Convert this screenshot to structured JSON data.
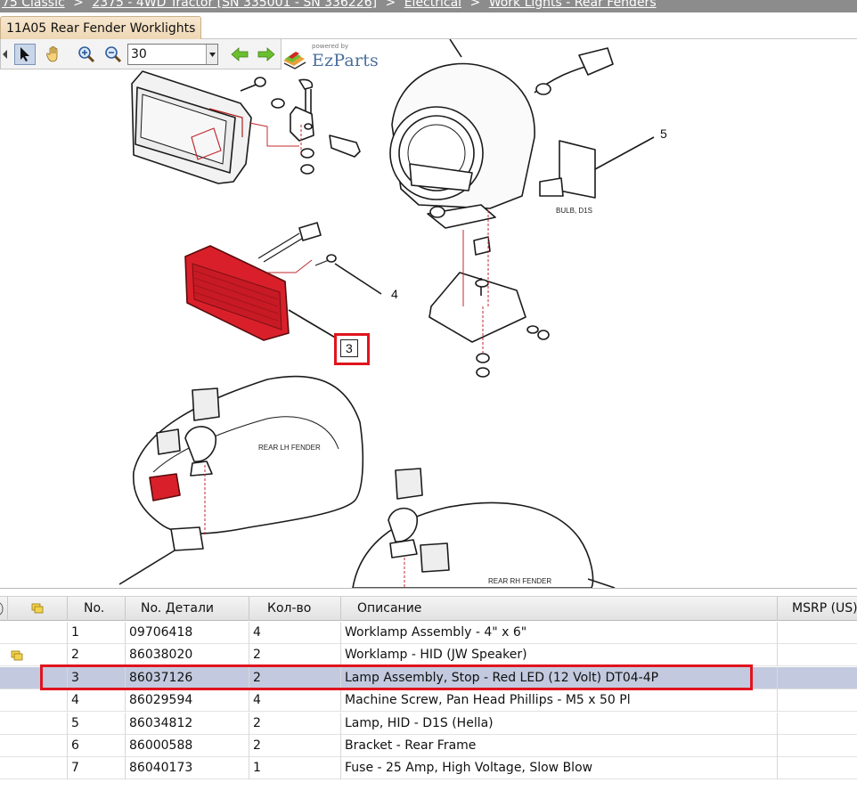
{
  "breadcrumb": {
    "items": [
      "75 Classic",
      "2375 - 4WD Tractor [SN 335001 - SN 336226]",
      "Electrical",
      "Work Lights - Rear Fenders"
    ],
    "separator": ">"
  },
  "tab": {
    "label": "11A05 Rear Fender Worklights"
  },
  "toolbar": {
    "zoom_value": "30",
    "powered_by": "powered by",
    "brand": "EzParts",
    "icons": [
      "select-arrow-icon",
      "pan-hand-icon",
      "zoom-in-icon",
      "zoom-out-icon",
      "prev-arrow-icon",
      "next-arrow-icon",
      "ezparts-logo-icon"
    ]
  },
  "diagram": {
    "callouts": [
      "3",
      "4",
      "5"
    ],
    "labels": {
      "bulb": "BULB, D1S",
      "lh_fender": "REAR LH FENDER",
      "rh_fender": "REAR RH FENDER"
    },
    "highlight_color": "#e0141e",
    "lamp_red": "#d9202a"
  },
  "grid": {
    "headers": {
      "no": "No.",
      "part_no": "No. Детали",
      "qty": "Кол-во",
      "desc": "Описание",
      "msrp": "MSRP (US)"
    },
    "rows": [
      {
        "no": "1",
        "part": "09706418",
        "qty": "4",
        "desc": "Worklamp Assembly - 4\" x 6\"",
        "note": false
      },
      {
        "no": "2",
        "part": "86038020",
        "qty": "2",
        "desc": "Worklamp - HID (JW Speaker)",
        "note": true
      },
      {
        "no": "3",
        "part": "86037126",
        "qty": "2",
        "desc": "Lamp Assembly, Stop - Red LED (12 Volt) DT04-4P",
        "note": false,
        "selected": true
      },
      {
        "no": "4",
        "part": "86029594",
        "qty": "4",
        "desc": "Machine Screw, Pan Head Phillips - M5 x 50 Pl",
        "note": false
      },
      {
        "no": "5",
        "part": "86034812",
        "qty": "2",
        "desc": "Lamp, HID - D1S (Hella)",
        "note": false
      },
      {
        "no": "6",
        "part": "86000588",
        "qty": "2",
        "desc": "Bracket - Rear Frame",
        "note": false
      },
      {
        "no": "7",
        "part": "86040173",
        "qty": "1",
        "desc": "Fuse - 25 Amp, High Voltage, Slow Blow",
        "note": false
      }
    ],
    "selected_color": "#c3cadf",
    "note_icon_color": "#e8c21a"
  }
}
